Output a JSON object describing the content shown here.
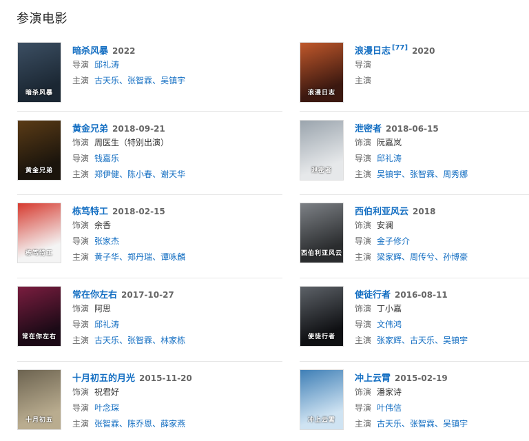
{
  "section_title": "参演电影",
  "movies": [
    {
      "title": "暗杀风暴",
      "year": "2022",
      "ref": "",
      "role_label": "",
      "role": "",
      "director_label": "导演",
      "director": "邱礼涛",
      "cast_label": "主演",
      "cast": [
        "古天乐",
        "张智霖",
        "吴镇宇"
      ],
      "poster_text": "暗杀风暴",
      "poster_colors": [
        "#1b2733",
        "#3c4f63"
      ]
    },
    {
      "title": "浪漫日志",
      "year": "2020",
      "ref": "[77]",
      "role_label": "",
      "role": "",
      "director_label": "导演",
      "director": "",
      "cast_label": "主演",
      "cast": [],
      "poster_text": "浪漫日志",
      "poster_colors": [
        "#3b1810",
        "#c0582b"
      ]
    },
    {
      "title": "黄金兄弟",
      "year": "2018-09-21",
      "ref": "",
      "role_label": "饰演",
      "role": "周医生（特别出演）",
      "director_label": "导演",
      "director": "钱嘉乐",
      "cast_label": "主演",
      "cast": [
        "郑伊健",
        "陈小春",
        "谢天华"
      ],
      "poster_text": "黄金兄弟",
      "poster_colors": [
        "#1a140c",
        "#5a3b16"
      ]
    },
    {
      "title": "泄密者",
      "year": "2018-06-15",
      "ref": "",
      "role_label": "饰演",
      "role": "阮嘉岚",
      "director_label": "导演",
      "director": "邱礼涛",
      "cast_label": "主演",
      "cast": [
        "吴镇宇",
        "张智霖",
        "周秀娜"
      ],
      "poster_text": "泄密者",
      "poster_colors": [
        "#e6e8ea",
        "#9aa4ad"
      ]
    },
    {
      "title": "栋笃特工",
      "year": "2018-02-15",
      "ref": "",
      "role_label": "饰演",
      "role": "余香",
      "director_label": "导演",
      "director": "张家杰",
      "cast_label": "主演",
      "cast": [
        "黄子华",
        "郑丹瑞",
        "谭咏麟"
      ],
      "poster_text": "栋笃特工",
      "poster_colors": [
        "#f4f4f4",
        "#d63a2f"
      ]
    },
    {
      "title": "西伯利亚风云",
      "year": "2018",
      "ref": "",
      "role_label": "饰演",
      "role": "安澜",
      "director_label": "导演",
      "director": "金子修介",
      "cast_label": "主演",
      "cast": [
        "梁家辉",
        "周传兮",
        "孙博豪"
      ],
      "poster_text": "西伯利亚风云",
      "poster_colors": [
        "#2a2c2e",
        "#7d8186"
      ]
    },
    {
      "title": "常在你左右",
      "year": "2017-10-27",
      "ref": "",
      "role_label": "饰演",
      "role": "阿思",
      "director_label": "导演",
      "director": "邱礼涛",
      "cast_label": "主演",
      "cast": [
        "古天乐",
        "张智霖",
        "林家栋"
      ],
      "poster_text": "常在你左右",
      "poster_colors": [
        "#1b0a16",
        "#7a1d3f"
      ]
    },
    {
      "title": "使徒行者",
      "year": "2016-08-11",
      "ref": "",
      "role_label": "饰演",
      "role": "丁小嘉",
      "director_label": "导演",
      "director": "文伟鸿",
      "cast_label": "主演",
      "cast": [
        "张家辉",
        "古天乐",
        "吴镇宇"
      ],
      "poster_text": "使徒行者",
      "poster_colors": [
        "#0f1013",
        "#5d6268"
      ]
    },
    {
      "title": "十月初五的月光",
      "year": "2015-11-20",
      "ref": "",
      "role_label": "饰演",
      "role": "祝君好",
      "director_label": "导演",
      "director": "叶念琛",
      "cast_label": "主演",
      "cast": [
        "张智霖",
        "陈乔恩",
        "薛家燕"
      ],
      "poster_text": "十月初五",
      "poster_colors": [
        "#b9ac8f",
        "#6c6350"
      ]
    },
    {
      "title": "冲上云霄",
      "year": "2015-02-19",
      "ref": "",
      "role_label": "饰演",
      "role": "潘家诗",
      "director_label": "导演",
      "director": "叶伟信",
      "cast_label": "主演",
      "cast": [
        "古天乐",
        "张智霖",
        "吴镇宇"
      ],
      "poster_text": "冲上云霄",
      "poster_colors": [
        "#cfe3f2",
        "#3f7fb6"
      ]
    }
  ]
}
